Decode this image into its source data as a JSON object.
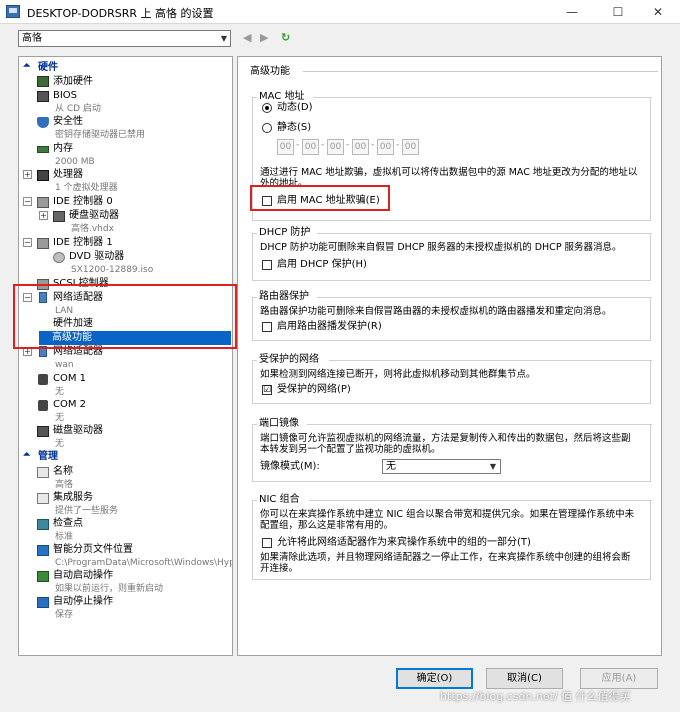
{
  "window": {
    "title": "DESKTOP-DODRSRR 上 高恪 的设置",
    "controls": {
      "minimize": "—",
      "maximize": "☐",
      "close": "✕"
    }
  },
  "vm_selector": {
    "value": "高恪"
  },
  "nav_icons": {
    "back": "◀",
    "forward": "▶",
    "refresh": "↻"
  },
  "left_panel": {
    "hardware_header": "硬件",
    "management_header": "管理",
    "items": {
      "add_hardware": "添加硬件",
      "bios": "BIOS",
      "bios_sub": "从 CD 启动",
      "security": "安全性",
      "security_sub": "密钥存储驱动器已禁用",
      "memory": "内存",
      "memory_sub": "2000 MB",
      "processor": "处理器",
      "processor_sub": "1 个虚拟处理器",
      "ide0": "IDE 控制器 0",
      "hdd": "硬盘驱动器",
      "hdd_sub": "高恪.vhdx",
      "ide1": "IDE 控制器 1",
      "dvd": "DVD 驱动器",
      "dvd_sub": "SX1200-12889.iso",
      "scsi": "SCSI 控制器",
      "netadapter1": "网络适配器",
      "netadapter1_sub": "LAN",
      "hw_accel": "硬件加速",
      "advanced": "高级功能",
      "netadapter2": "网络适配器",
      "netadapter2_sub": "wan",
      "com1": "COM 1",
      "com1_sub": "无",
      "com2": "COM 2",
      "com2_sub": "无",
      "floppy": "磁盘驱动器",
      "floppy_sub": "无",
      "name": "名称",
      "name_sub": "高恪",
      "integration": "集成服务",
      "integration_sub": "提供了一些服务",
      "checkpoint": "检查点",
      "checkpoint_sub": "标准",
      "paging": "智能分页文件位置",
      "paging_sub": "C:\\ProgramData\\Microsoft\\Windows\\Hyper-V",
      "autostart": "自动启动操作",
      "autostart_sub": "如果以前运行，则重新启动",
      "autostop": "自动停止操作",
      "autostop_sub": "保存"
    }
  },
  "right_panel": {
    "heading": "高级功能",
    "mac": {
      "title": "MAC 地址",
      "dynamic": "动态(D)",
      "static": "静态(S)",
      "octets": [
        "00",
        "00",
        "00",
        "00",
        "00",
        "00"
      ],
      "desc": "通过进行 MAC 地址欺骗，虚拟机可以将传出数据包中的源 MAC 地址更改为分配的地址以\n外的地址。",
      "spoof_label": "启用 MAC 地址欺骗(E)"
    },
    "dhcp": {
      "title": "DHCP 防护",
      "desc": "DHCP 防护功能可删除来自假冒 DHCP 服务器的未授权虚拟机的 DHCP 服务器消息。",
      "label": "启用 DHCP 保护(H)"
    },
    "router": {
      "title": "路由器保护",
      "desc": "路由器保护功能可删除来自假冒路由器的未授权虚拟机的路由器播发和重定向消息。",
      "label": "启用路由器播发保护(R)"
    },
    "protected": {
      "title": "受保护的网络",
      "desc": "如果检测到网络连接已断开，则将此虚拟机移动到其他群集节点。",
      "label": "受保护的网络(P)",
      "check": "☑"
    },
    "mirror": {
      "title": "端口镜像",
      "desc": "端口镜像可允许监视虚拟机的网络流量，方法是复制传入和传出的数据包，然后将这些副\n本转发到另一个配置了监视功能的虚拟机。",
      "mode_label": "镜像模式(M):",
      "mode_value": "无"
    },
    "nic": {
      "title": "NIC 组合",
      "desc": "你可以在来宾操作系统中建立 NIC 组合以聚合带宽和提供冗余。如果在管理操作系统中未\n配置组，那么这是非常有用的。",
      "label": "允许将此网络适配器作为来宾操作系统中的组的一部分(T)",
      "desc2": "如果清除此选项，并且物理网络适配器之一停止工作，在来宾操作系统中创建的组将会断\n开连接。"
    }
  },
  "buttons": {
    "ok": "确定(O)",
    "cancel": "取消(C)",
    "apply": "应用(A)"
  },
  "watermark": "https://blog.csdn.net/  值 什么值得买",
  "icons": {
    "collapse": "collapse-icon",
    "expand": "expand-icon"
  }
}
